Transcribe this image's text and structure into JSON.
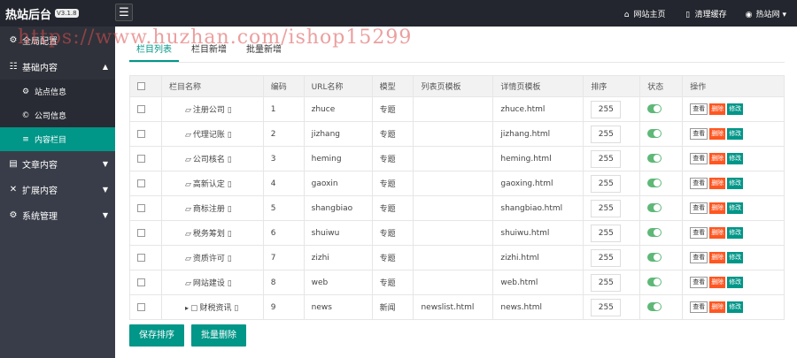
{
  "header": {
    "title": "热站后台",
    "version": "V3.1.8",
    "links": [
      {
        "icon": "home-icon",
        "glyph": "⌂",
        "label": "网站主页"
      },
      {
        "icon": "trash-icon",
        "glyph": "🗑",
        "label": "清理缓存"
      },
      {
        "icon": "user-icon",
        "glyph": "☺",
        "label": "热站网"
      }
    ]
  },
  "watermark": "https://www.huzhan.com/ishop15299",
  "sidebar": {
    "home": "全局配置",
    "basic": {
      "label": "基础内容",
      "items": [
        {
          "label": "站点信息",
          "glyph": "⚙"
        },
        {
          "label": "公司信息",
          "glyph": "©"
        },
        {
          "label": "内容栏目",
          "glyph": "≡"
        }
      ]
    },
    "groups": [
      {
        "label": "文章内容",
        "glyph": "🗎"
      },
      {
        "label": "扩展内容",
        "glyph": "✕"
      },
      {
        "label": "系统管理",
        "glyph": "⚙"
      }
    ]
  },
  "tabs": [
    "栏目列表",
    "栏目新增",
    "批量新增"
  ],
  "table": {
    "headers": [
      "栏目名称",
      "编码",
      "URL名称",
      "模型",
      "列表页模板",
      "详情页模板",
      "排序",
      "状态",
      "操作"
    ],
    "rows": [
      {
        "name": "注册公司",
        "code": "1",
        "url": "zhuce",
        "model": "专题",
        "list_tpl": "",
        "detail_tpl": "zhuce.html",
        "sort": "255"
      },
      {
        "name": "代理记账",
        "code": "2",
        "url": "jizhang",
        "model": "专题",
        "list_tpl": "",
        "detail_tpl": "jizhang.html",
        "sort": "255"
      },
      {
        "name": "公司核名",
        "code": "3",
        "url": "heming",
        "model": "专题",
        "list_tpl": "",
        "detail_tpl": "heming.html",
        "sort": "255"
      },
      {
        "name": "高新认定",
        "code": "4",
        "url": "gaoxin",
        "model": "专题",
        "list_tpl": "",
        "detail_tpl": "gaoxing.html",
        "sort": "255"
      },
      {
        "name": "商标注册",
        "code": "5",
        "url": "shangbiao",
        "model": "专题",
        "list_tpl": "",
        "detail_tpl": "shangbiao.html",
        "sort": "255"
      },
      {
        "name": "税务筹划",
        "code": "6",
        "url": "shuiwu",
        "model": "专题",
        "list_tpl": "",
        "detail_tpl": "shuiwu.html",
        "sort": "255"
      },
      {
        "name": "资质许可",
        "code": "7",
        "url": "zizhi",
        "model": "专题",
        "list_tpl": "",
        "detail_tpl": "zizhi.html",
        "sort": "255"
      },
      {
        "name": "网站建设",
        "code": "8",
        "url": "web",
        "model": "专题",
        "list_tpl": "",
        "detail_tpl": "web.html",
        "sort": "255"
      },
      {
        "name": "财税资讯",
        "code": "9",
        "url": "news",
        "model": "新闻",
        "list_tpl": "newslist.html",
        "detail_tpl": "news.html",
        "sort": "255",
        "has_children": true
      }
    ],
    "actions": {
      "view": "查看",
      "delete": "删除",
      "edit": "修改"
    }
  },
  "buttons": {
    "save_sort": "保存排序",
    "batch_delete": "批量删除"
  },
  "colors": {
    "accent": "#009688",
    "danger": "#ff5722",
    "topbar": "#23262e",
    "sidebar": "#393d49",
    "switch_on": "#5fb878"
  }
}
